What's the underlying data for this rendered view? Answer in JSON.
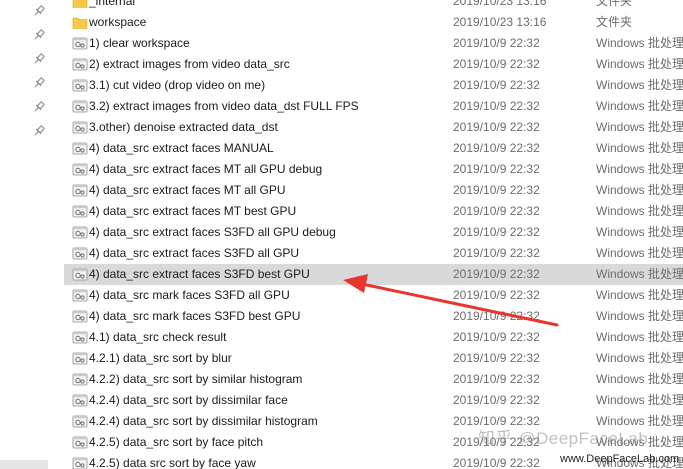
{
  "files": [
    {
      "name": "_internal",
      "date": "2019/10/23 13:16",
      "type": "文件夹",
      "kind": "folder"
    },
    {
      "name": "workspace",
      "date": "2019/10/23 13:16",
      "type": "文件夹",
      "kind": "folder"
    },
    {
      "name": "1) clear workspace",
      "date": "2019/10/9 22:32",
      "type": "Windows 批处理",
      "kind": "batch"
    },
    {
      "name": "2) extract images from video data_src",
      "date": "2019/10/9 22:32",
      "type": "Windows 批处理",
      "kind": "batch"
    },
    {
      "name": "3.1) cut video (drop video on me)",
      "date": "2019/10/9 22:32",
      "type": "Windows 批处理",
      "kind": "batch"
    },
    {
      "name": "3.2) extract images from video data_dst FULL FPS",
      "date": "2019/10/9 22:32",
      "type": "Windows 批处理",
      "kind": "batch"
    },
    {
      "name": "3.other) denoise extracted data_dst",
      "date": "2019/10/9 22:32",
      "type": "Windows 批处理",
      "kind": "batch"
    },
    {
      "name": "4) data_src extract faces MANUAL",
      "date": "2019/10/9 22:32",
      "type": "Windows 批处理",
      "kind": "batch"
    },
    {
      "name": "4) data_src extract faces MT all GPU debug",
      "date": "2019/10/9 22:32",
      "type": "Windows 批处理",
      "kind": "batch"
    },
    {
      "name": "4) data_src extract faces MT all GPU",
      "date": "2019/10/9 22:32",
      "type": "Windows 批处理",
      "kind": "batch"
    },
    {
      "name": "4) data_src extract faces MT best GPU",
      "date": "2019/10/9 22:32",
      "type": "Windows 批处理",
      "kind": "batch"
    },
    {
      "name": "4) data_src extract faces S3FD all GPU debug",
      "date": "2019/10/9 22:32",
      "type": "Windows 批处理",
      "kind": "batch"
    },
    {
      "name": "4) data_src extract faces S3FD all GPU",
      "date": "2019/10/9 22:32",
      "type": "Windows 批处理",
      "kind": "batch"
    },
    {
      "name": "4) data_src extract faces S3FD best GPU",
      "date": "2019/10/9 22:32",
      "type": "Windows 批处理",
      "kind": "batch",
      "selected": true
    },
    {
      "name": "4) data_src mark faces S3FD all GPU",
      "date": "2019/10/9 22:32",
      "type": "Windows 批处理",
      "kind": "batch"
    },
    {
      "name": "4) data_src mark faces S3FD best GPU",
      "date": "2019/10/9 22:32",
      "type": "Windows 批处理",
      "kind": "batch"
    },
    {
      "name": "4.1) data_src check result",
      "date": "2019/10/9 22:32",
      "type": "Windows 批处理",
      "kind": "batch"
    },
    {
      "name": "4.2.1) data_src sort by blur",
      "date": "2019/10/9 22:32",
      "type": "Windows 批处理",
      "kind": "batch"
    },
    {
      "name": "4.2.2) data_src sort by similar histogram",
      "date": "2019/10/9 22:32",
      "type": "Windows 批处理",
      "kind": "batch"
    },
    {
      "name": "4.2.4) data_src sort by dissimilar face",
      "date": "2019/10/9 22:32",
      "type": "Windows 批处理",
      "kind": "batch"
    },
    {
      "name": "4.2.4) data_src sort by dissimilar histogram",
      "date": "2019/10/9 22:32",
      "type": "Windows 批处理",
      "kind": "batch"
    },
    {
      "name": "4.2.5) data_src sort by face pitch",
      "date": "2019/10/9 22:32",
      "type": "Windows 批处理",
      "kind": "batch"
    },
    {
      "name": "4.2.5) data src sort by face yaw",
      "date": "2019/10/9 22:32",
      "type": "Windows 批处理",
      "kind": "batch"
    }
  ],
  "pins": [
    "pin-icon",
    "pin-icon",
    "pin-icon",
    "pin-icon",
    "pin-icon",
    "pin-icon"
  ],
  "watermark": "知乎 @DeepFaceLab",
  "site_mark": "www.DeepFaceLab.com",
  "colors": {
    "selected_row": "#d9d9d9",
    "folder": "#f6c94b",
    "arrow": "#e8352e",
    "muted_text": "#6d6d6d"
  }
}
